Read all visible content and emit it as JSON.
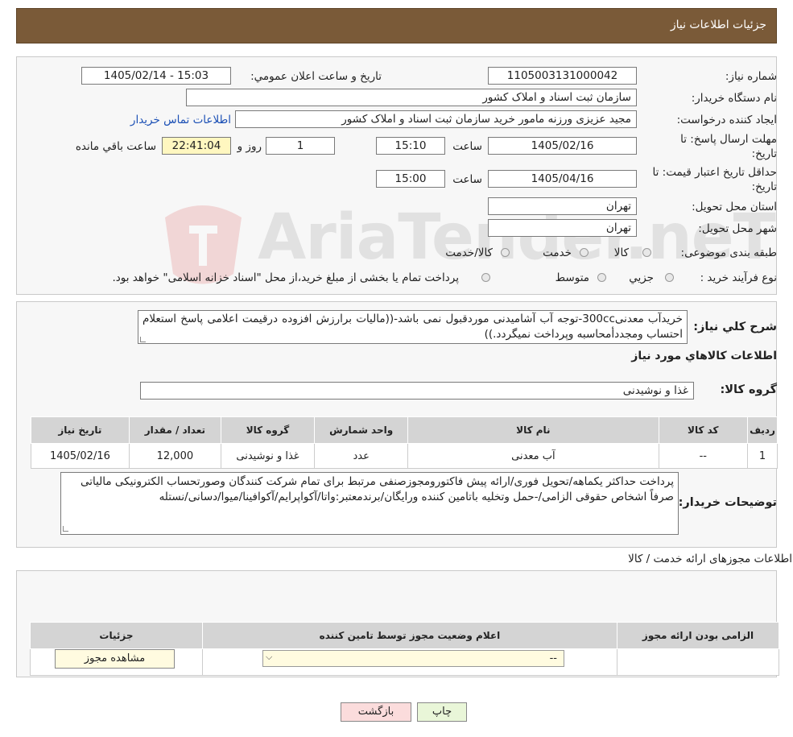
{
  "header": {
    "title": "جزئیات اطلاعات نیاز"
  },
  "watermark": {
    "text": "AriaTender.neT"
  },
  "fields": {
    "need_number_label": "شماره نیاز:",
    "need_number": "1105003131000042",
    "announce_label": "تاریخ و ساعت اعلان عمومي:",
    "announce_value": "1405/02/14 - 15:03",
    "buyer_org_label": "نام دستگاه خريدار:",
    "buyer_org": "سازمان ثبت اسناد و املاک کشور",
    "creator_label": "ايجاد کننده درخواست:",
    "creator": "مجید عزیزی ورزنه مامور خرید سازمان ثبت اسناد و املاک کشور",
    "contact_link": "اطلاعات تماس خريدار",
    "reply_deadline_label": "مهلت ارسال پاسخ: تا تاريخ:",
    "reply_date": "1405/02/16",
    "time_word": "ساعت",
    "reply_time": "15:10",
    "days_value": "1",
    "days_word": "روز و",
    "remaining_time": "22:41:04",
    "remaining_word": "ساعت باقي مانده",
    "price_valid_label": "حداقل تاريخ اعتبار قيمت: تا تاريخ:",
    "price_date": "1405/04/16",
    "price_time": "15:00",
    "province_label": "استان محل تحويل:",
    "province": "تهران",
    "city_label": "شهر محل تحويل:",
    "city": "تهران",
    "category_label": "طبقه بندی موضوعی:",
    "category_options": [
      "کالا",
      "خدمت",
      "کالا/خدمت"
    ],
    "process_label": "نوع فرآيند خريد :",
    "process_options": [
      "جزيي",
      "متوسط"
    ],
    "process_note": "پرداخت تمام یا بخشی از مبلغ خرید،از محل \"اسناد خزانه اسلامی\" خواهد بود."
  },
  "description": {
    "label": "شرح کلي نياز:",
    "text": "خریدآب معدنی300cc-توجه آب آشامیدنی موردقبول نمی باشد-((مالیات برارزش افزوده درقیمت اعلامی پاسخ استعلام احتساب ومجددأمحاسبه وپرداخت نمیگردد.))"
  },
  "goods": {
    "section_title": "اطلاعات کالاهاي مورد نياز",
    "group_label": "گروه کالا:",
    "group_value": "غذا و نوشیدنی",
    "columns": [
      "رديف",
      "کد کالا",
      "نام کالا",
      "واحد شمارش",
      "گروه کالا",
      "تعداد / مقدار",
      "تاريخ نياز"
    ],
    "rows": [
      [
        "1",
        "--",
        "آب معدنی",
        "عدد",
        "غذا و نوشیدنی",
        "12,000",
        "1405/02/16"
      ]
    ]
  },
  "buyer_notes": {
    "label": "توضيحات خريدار:",
    "text": "پرداخت حداکثر یکماهه/تحویل فوری/ارائه پیش فاکتورومجوزصنفی مرتبط برای تمام شرکت کنندگان وصورتحساب الکترونیکی مالیاتی صرفاً اشخاص حقوقی الزامی/-حمل وتخلیه باتامین کننده ورایگان/برندمعتبر:واتا/آکواپرایم/آکوافینا/میوا/دسانی/نستله"
  },
  "licenses": {
    "section_title": "اطلاعات مجوزهای ارائه خدمت / کالا",
    "columns": [
      "الزامی بودن ارائه مجوز",
      "اعلام وضعیت مجوز توسط تامین کننده",
      "جزئیات"
    ],
    "select_value": "--",
    "view_button": "مشاهده مجوز"
  },
  "buttons": {
    "print": "چاپ",
    "back": "بازگشت"
  }
}
